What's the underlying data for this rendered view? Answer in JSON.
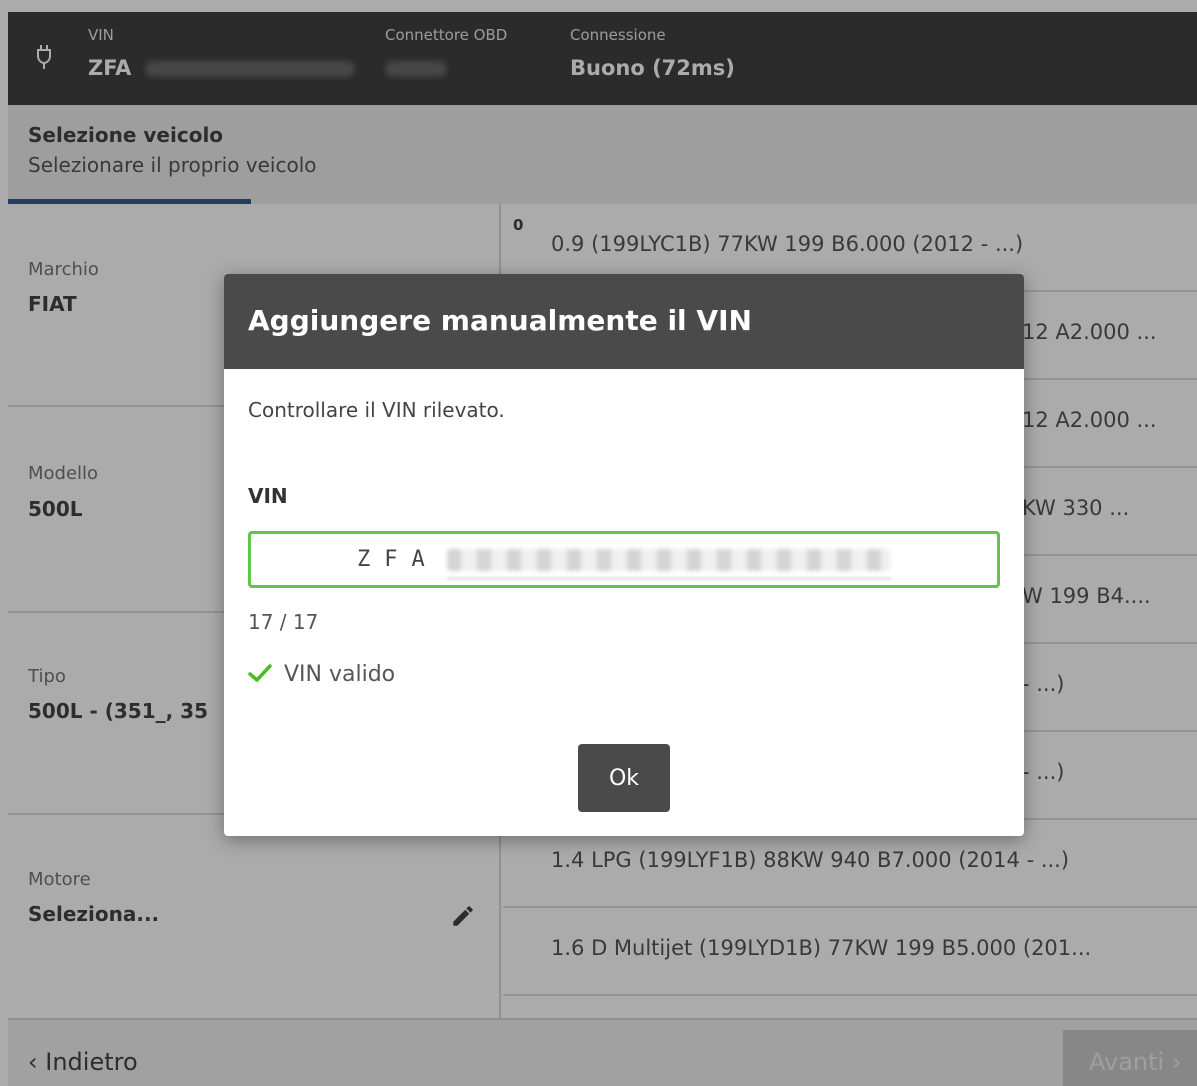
{
  "topbar": {
    "vin_label": "VIN",
    "vin_value": "ZFA",
    "obd_label": "Connettore OBD",
    "connection_label": "Connessione",
    "connection_value": "Buono (72ms)",
    "icon": "obd-plug-icon"
  },
  "subheader": {
    "title": "Selezione veicolo",
    "subtitle": "Selezionare il proprio veicolo",
    "progress_fraction": 0.2
  },
  "fields": [
    {
      "label": "Marchio",
      "value": "FIAT"
    },
    {
      "label": "Modello",
      "value": "500L"
    },
    {
      "label": "Tipo",
      "value": "500L - (351_, 35"
    },
    {
      "label": "Motore",
      "value": "Seleziona..."
    }
  ],
  "engine_list": {
    "group_label": "0",
    "items": [
      "0.9 (199LYC1B) 77KW 199 B6.000 (2012 - ...)",
      "12 A2.000 ...",
      "12 A2.000 ...",
      "KW 330 ...",
      "W 199 B4....",
      "- ...)",
      "- ...)",
      "1.4 LPG (199LYF1B) 88KW 940 B7.000 (2014 - ...)",
      "1.6 D Multijet (199LYD1B) 77KW 199 B5.000 (201..."
    ]
  },
  "footer": {
    "back_label": "Indietro",
    "next_label": "Avanti"
  },
  "dialog": {
    "title": "Aggiungere manualmente il VIN",
    "message": "Controllare il VIN rilevato.",
    "vin_label": "VIN",
    "vin_typed": "ZFA",
    "counter": "17 / 17",
    "valid_text": "VIN valido",
    "ok_label": "Ok"
  },
  "colors": {
    "topbar_bg": "#404040",
    "dialog_header_bg": "#4a4a4a",
    "input_border_valid": "#62c44a",
    "check_green": "#4cbb2a",
    "progress_blue": "#3a5a8c"
  }
}
